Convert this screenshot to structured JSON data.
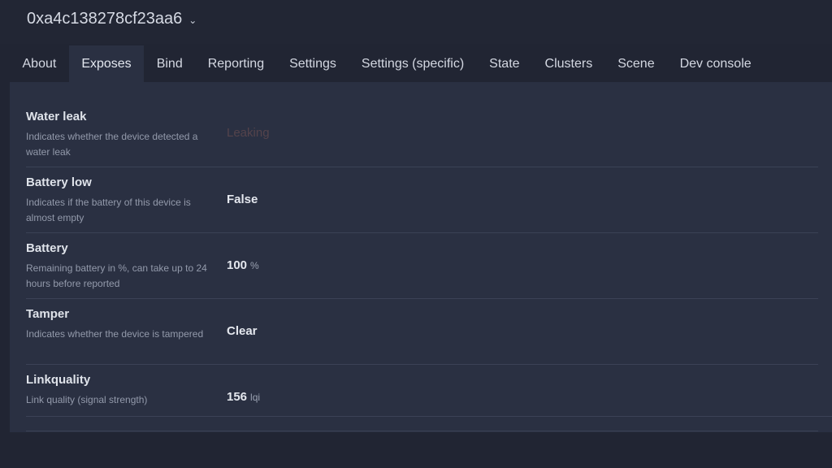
{
  "device": {
    "title": "0xa4c138278cf23aa6",
    "chevron_icon": "chevron-down-icon"
  },
  "tabs": [
    {
      "label": "About"
    },
    {
      "label": "Exposes",
      "active": true
    },
    {
      "label": "Bind"
    },
    {
      "label": "Reporting"
    },
    {
      "label": "Settings"
    },
    {
      "label": "Settings (specific)"
    },
    {
      "label": "State"
    },
    {
      "label": "Clusters"
    },
    {
      "label": "Scene"
    },
    {
      "label": "Dev console"
    }
  ],
  "exposes": [
    {
      "name": "Water leak",
      "description": "Indicates whether the device detected a water leak",
      "value": "Leaking",
      "unit": ""
    },
    {
      "name": "Battery low",
      "description": "Indicates if the battery of this device is almost empty",
      "value": "False",
      "unit": ""
    },
    {
      "name": "Battery",
      "description": "Remaining battery in %, can take up to 24 hours before reported",
      "value": "100",
      "unit": "%"
    },
    {
      "name": "Tamper",
      "description": "Indicates whether the device is tampered",
      "value": "Clear",
      "unit": ""
    },
    {
      "name": "Linkquality",
      "description": "Link quality (signal strength)",
      "value": "156",
      "unit": "lqi"
    }
  ],
  "colors": {
    "background": "#212533",
    "panel": "#2a3042",
    "dim_value": "#54434b"
  }
}
